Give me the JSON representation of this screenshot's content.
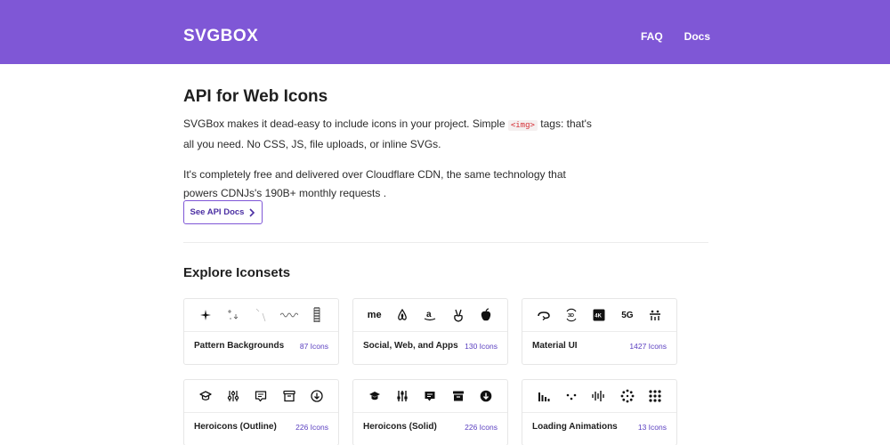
{
  "header": {
    "logo": "SVGBOX",
    "nav": [
      {
        "label": "FAQ"
      },
      {
        "label": "Docs"
      }
    ],
    "bg_color": "#7f57d6"
  },
  "hero": {
    "title": "API for Web Icons",
    "p1_before": "SVGBox makes it dead-easy to include icons in your project. Simple ",
    "p1_code": "<img>",
    "p1_after": " tags: that's all you need. No CSS, JS, file uploads, or inline SVGs.",
    "p2": "It's completely free and delivered over Cloudflare CDN, the same technology that powers CDNJs's 190B+ monthly requests .",
    "button_label": "See API Docs"
  },
  "explore": {
    "title": "Explore Iconsets",
    "cards": [
      {
        "name": "Pattern Backgrounds",
        "count": "87 Icons",
        "icons": [
          "sparkle-icon",
          "anchor-pattern-icon",
          "slash-pattern-icon",
          "wave-pattern-icon",
          "zigzag-pattern-icon"
        ]
      },
      {
        "name": "Social, Web, and Apps",
        "count": "130 Icons",
        "icons": [
          "me-icon",
          "airbnb-icon",
          "amazon-icon",
          "angellist-icon",
          "apple-icon"
        ]
      },
      {
        "name": "Material UI",
        "count": "1427 Icons",
        "icons": [
          "360-icon",
          "3d-rotation-icon",
          "4k-icon",
          "5g-icon",
          "accessibility-icon"
        ]
      },
      {
        "name": "Heroicons (Outline)",
        "count": "226 Icons",
        "icons": [
          "academic-cap-icon",
          "adjustments-icon",
          "annotation-icon",
          "archive-icon",
          "arrow-circle-down-icon"
        ]
      },
      {
        "name": "Heroicons (Solid)",
        "count": "226 Icons",
        "icons": [
          "academic-cap-icon",
          "adjustments-icon",
          "annotation-icon",
          "archive-icon",
          "arrow-circle-down-icon"
        ]
      },
      {
        "name": "Loading Animations",
        "count": "13 Icons",
        "icons": [
          "bars-icon",
          "three-dots-icon",
          "audio-icon",
          "ball-triangle-icon",
          "grid-icon"
        ]
      }
    ],
    "me_text": "me",
    "fourk_text": "4K",
    "fiveg_text": "5G",
    "threed_text": "3D",
    "accent_color": "#5a3fc0"
  }
}
